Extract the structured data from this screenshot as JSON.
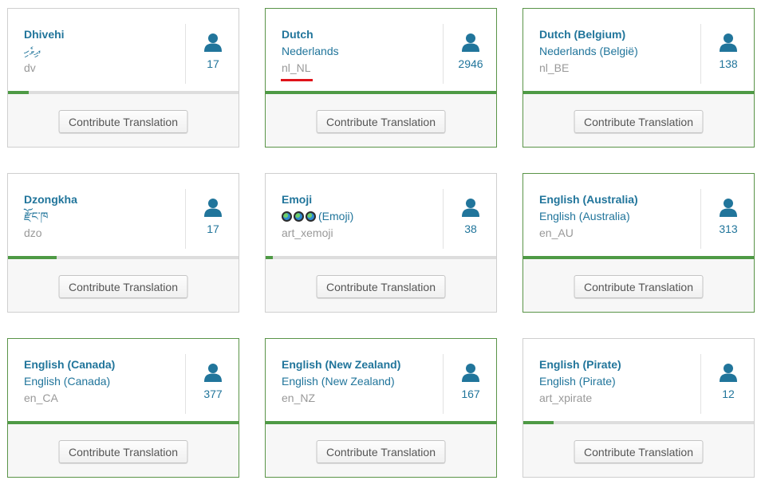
{
  "button_label": "Contribute Translation",
  "colors": {
    "link": "#21759b",
    "muted": "#999999",
    "progress": "#4e9a45",
    "complete_border": "#5a9448",
    "highlight": "#e0131a"
  },
  "icons": {
    "contributors": "person-icon",
    "emoji": "globe-emoji-icon"
  },
  "cards": [
    {
      "name": "Dhivehi",
      "native": "ދިވެހި",
      "locale": "dv",
      "contributors": "17",
      "progress": 9
    },
    {
      "name": "Dutch",
      "native": "Nederlands",
      "locale": "nl_NL",
      "contributors": "2946",
      "progress": 100
    },
    {
      "name": "Dutch (Belgium)",
      "native": "Nederlands (België)",
      "locale": "nl_BE",
      "contributors": "138",
      "progress": 100
    },
    {
      "name": "Dzongkha",
      "native": "རྫོང་ཁ",
      "locale": "dzo",
      "contributors": "17",
      "progress": 21
    },
    {
      "name": "Emoji",
      "native": "(Emoji)",
      "locale": "art_xemoji",
      "contributors": "38",
      "progress": 3
    },
    {
      "name": "English (Australia)",
      "native": "English (Australia)",
      "locale": "en_AU",
      "contributors": "313",
      "progress": 100
    },
    {
      "name": "English (Canada)",
      "native": "English (Canada)",
      "locale": "en_CA",
      "contributors": "377",
      "progress": 100
    },
    {
      "name": "English (New Zealand)",
      "native": "English (New Zealand)",
      "locale": "en_NZ",
      "contributors": "167",
      "progress": 100
    },
    {
      "name": "English (Pirate)",
      "native": "English (Pirate)",
      "locale": "art_xpirate",
      "contributors": "12",
      "progress": 13
    }
  ]
}
